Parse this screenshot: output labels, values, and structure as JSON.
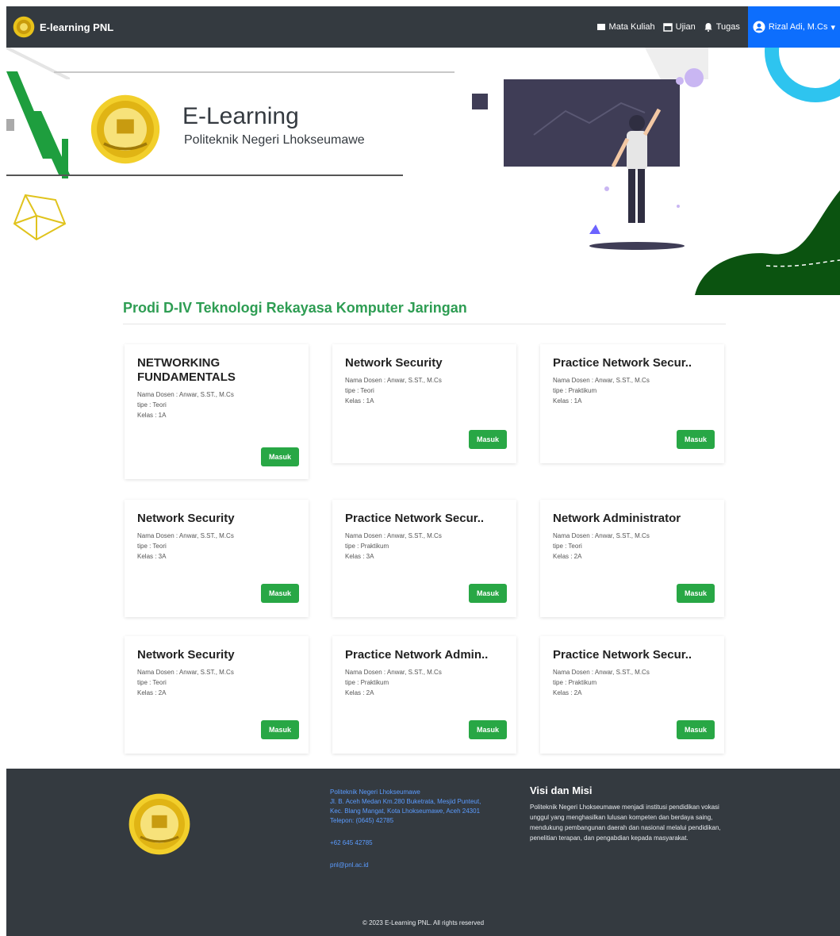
{
  "navbar": {
    "brand": "E-learning PNL",
    "links": [
      {
        "label": "Mata Kuliah",
        "icon": "book-icon"
      },
      {
        "label": "Ujian",
        "icon": "calendar-icon"
      },
      {
        "label": "Tugas",
        "icon": "bell-icon"
      }
    ],
    "user_label": "Rizal Adi, M.Cs"
  },
  "hero": {
    "title": "E-Learning",
    "subtitle": "Politeknik Negeri Lhokseumawe"
  },
  "prodi": {
    "title": "Prodi D-IV Teknologi Rekayasa Komputer Jaringan"
  },
  "courses": [
    {
      "title": "NETWORKING FUNDAMENTALS",
      "dosen": "Nama Dosen : Anwar, S.ST., M.Cs",
      "tipe": "tipe : Teori",
      "kelas": "Kelas : 1A",
      "button": "Masuk"
    },
    {
      "title": "Network Security",
      "dosen": "Nama Dosen : Anwar, S.ST., M.Cs",
      "tipe": "tipe : Teori",
      "kelas": "Kelas : 1A",
      "button": "Masuk"
    },
    {
      "title": "Practice Network Secur..",
      "dosen": "Nama Dosen : Anwar, S.ST., M.Cs",
      "tipe": "tipe : Praktikum",
      "kelas": "Kelas : 1A",
      "button": "Masuk"
    },
    {
      "title": "Network Security",
      "dosen": "Nama Dosen : Anwar, S.ST., M.Cs",
      "tipe": "tipe : Teori",
      "kelas": "Kelas : 3A",
      "button": "Masuk"
    },
    {
      "title": "Practice Network Secur..",
      "dosen": "Nama Dosen : Anwar, S.ST., M.Cs",
      "tipe": "tipe : Praktikum",
      "kelas": "Kelas : 3A",
      "button": "Masuk"
    },
    {
      "title": "Network Administrator",
      "dosen": "Nama Dosen : Anwar, S.ST., M.Cs",
      "tipe": "tipe : Teori",
      "kelas": "Kelas : 2A",
      "button": "Masuk"
    },
    {
      "title": "Network Security",
      "dosen": "Nama Dosen : Anwar, S.ST., M.Cs",
      "tipe": "tipe : Teori",
      "kelas": "Kelas : 2A",
      "button": "Masuk"
    },
    {
      "title": "Practice Network Admin..",
      "dosen": "Nama Dosen : Anwar, S.ST., M.Cs",
      "tipe": "tipe : Praktikum",
      "kelas": "Kelas : 2A",
      "button": "Masuk"
    },
    {
      "title": "Practice Network Secur..",
      "dosen": "Nama Dosen : Anwar, S.ST., M.Cs",
      "tipe": "tipe : Praktikum",
      "kelas": "Kelas : 2A",
      "button": "Masuk"
    }
  ],
  "footer": {
    "address": [
      "Politeknik Negeri Lhokseumawe",
      "Jl. B. Aceh Medan Km.280 Buketrata, Mesjid Punteut,",
      "Kec. Blang Mangat, Kota Lhokseumawe, Aceh 24301",
      "Telepon: (0645) 42785"
    ],
    "phone": "+62 645 42785",
    "email": "pnl@pnl.ac.id",
    "visi_title": "Visi dan Misi",
    "visi_text": "Politeknik Negeri Lhokseumawe menjadi institusi pendidikan vokasi unggul yang menghasilkan lulusan kompeten dan berdaya saing, mendukung pembangunan daerah dan nasional melalui pendidikan, penelitian terapan, dan pengabdian kepada masyarakat.",
    "copyright": "© 2023 E-Learning PNL. All rights reserved"
  },
  "colors": {
    "navbar": "#343a40",
    "accent_green": "#28a745",
    "title_green": "#2e9d53",
    "user_blue": "#0d6efd"
  }
}
